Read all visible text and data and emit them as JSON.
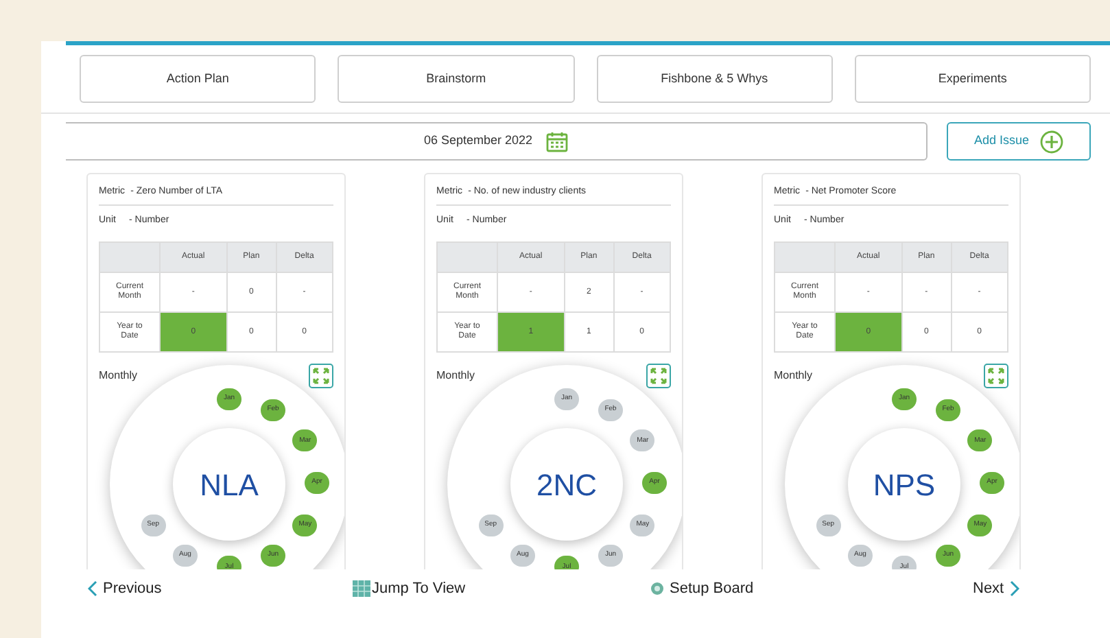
{
  "tabs": [
    {
      "label": "Action Plan"
    },
    {
      "label": "Brainstorm"
    },
    {
      "label": "Fishbone & 5 Whys"
    },
    {
      "label": "Experiments"
    }
  ],
  "date": "06 September 2022",
  "add_button": "Add Issue",
  "cards": [
    {
      "metric_label": "Metric",
      "metric": "- Zero Number of LTA",
      "unit_label": "Unit",
      "unit": "- Number",
      "columns": [
        "Actual",
        "Plan",
        "Delta"
      ],
      "rows": [
        {
          "label": "Current Month",
          "cells": [
            {
              "value": "-",
              "highlighted": false
            },
            {
              "value": "0",
              "highlighted": false
            },
            {
              "value": "-",
              "highlighted": false
            }
          ]
        },
        {
          "label": "Year to Date",
          "cells": [
            {
              "value": "0",
              "highlighted": true
            },
            {
              "value": "0",
              "highlighted": false
            },
            {
              "value": "0",
              "highlighted": false
            }
          ]
        }
      ],
      "monthly_label": "Monthly",
      "code": "NLA",
      "months": [
        {
          "label": "Jan",
          "achieved": true
        },
        {
          "label": "Feb",
          "achieved": true
        },
        {
          "label": "Mar",
          "achieved": true
        },
        {
          "label": "Apr",
          "achieved": true
        },
        {
          "label": "May",
          "achieved": true
        },
        {
          "label": "Jun",
          "achieved": true
        },
        {
          "label": "Jul",
          "achieved": true
        },
        {
          "label": "Aug",
          "achieved": false
        },
        {
          "label": "Sep",
          "achieved": false
        }
      ]
    },
    {
      "metric_label": "Metric",
      "metric": "- No. of new industry clients",
      "unit_label": "Unit",
      "unit": "- Number",
      "columns": [
        "Actual",
        "Plan",
        "Delta"
      ],
      "rows": [
        {
          "label": "Current Month",
          "cells": [
            {
              "value": "-",
              "highlighted": false
            },
            {
              "value": "2",
              "highlighted": false
            },
            {
              "value": "-",
              "highlighted": false
            }
          ]
        },
        {
          "label": "Year to Date",
          "cells": [
            {
              "value": "1",
              "highlighted": true
            },
            {
              "value": "1",
              "highlighted": false
            },
            {
              "value": "0",
              "highlighted": false
            }
          ]
        }
      ],
      "monthly_label": "Monthly",
      "code": "2NC",
      "months": [
        {
          "label": "Jan",
          "achieved": false
        },
        {
          "label": "Feb",
          "achieved": false
        },
        {
          "label": "Mar",
          "achieved": false
        },
        {
          "label": "Apr",
          "achieved": true
        },
        {
          "label": "May",
          "achieved": false
        },
        {
          "label": "Jun",
          "achieved": false
        },
        {
          "label": "Jul",
          "achieved": true
        },
        {
          "label": "Aug",
          "achieved": false
        },
        {
          "label": "Sep",
          "achieved": false
        }
      ]
    },
    {
      "metric_label": "Metric",
      "metric": "- Net Promoter Score",
      "unit_label": "Unit",
      "unit": "- Number",
      "columns": [
        "Actual",
        "Plan",
        "Delta"
      ],
      "rows": [
        {
          "label": "Current Month",
          "cells": [
            {
              "value": "-",
              "highlighted": false
            },
            {
              "value": "-",
              "highlighted": false
            },
            {
              "value": "-",
              "highlighted": false
            }
          ]
        },
        {
          "label": "Year to Date",
          "cells": [
            {
              "value": "0",
              "highlighted": true
            },
            {
              "value": "0",
              "highlighted": false
            },
            {
              "value": "0",
              "highlighted": false
            }
          ]
        }
      ],
      "monthly_label": "Monthly",
      "code": "NPS",
      "months": [
        {
          "label": "Jan",
          "achieved": true
        },
        {
          "label": "Feb",
          "achieved": true
        },
        {
          "label": "Mar",
          "achieved": true
        },
        {
          "label": "Apr",
          "achieved": true
        },
        {
          "label": "May",
          "achieved": true
        },
        {
          "label": "Jun",
          "achieved": true
        },
        {
          "label": "Jul",
          "achieved": false
        },
        {
          "label": "Aug",
          "achieved": false
        },
        {
          "label": "Sep",
          "achieved": false
        }
      ]
    }
  ],
  "footer": {
    "previous": "Previous",
    "jump": "Jump To View",
    "setup": "Setup Board",
    "next": "Next"
  }
}
